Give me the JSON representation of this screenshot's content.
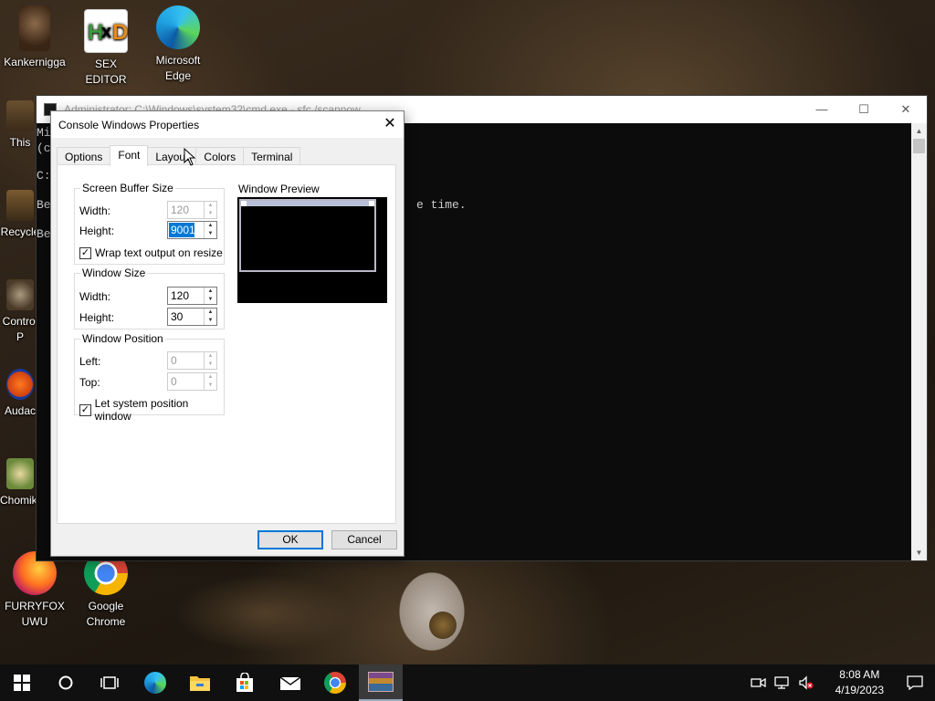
{
  "desktop": {
    "icons": [
      {
        "label": "Kankernigga"
      },
      {
        "label": "SEX\nEDITOR"
      },
      {
        "label": "Microsoft\nEdge"
      },
      {
        "label": "This"
      },
      {
        "label": "Recycle"
      },
      {
        "label": "Control P"
      },
      {
        "label": "Audac"
      },
      {
        "label": "ChomikS"
      },
      {
        "label": "FURRYFOX\nUWU"
      },
      {
        "label": "Google\nChrome"
      }
    ]
  },
  "console": {
    "title": "Administrator: C:\\Windows\\system32\\cmd.exe - sfc /scannow",
    "lines": [
      "Mi",
      "(c",
      "C:",
      "Be",
      "Be"
    ],
    "text_fragment": "e time."
  },
  "dialog": {
    "title": "Console Windows Properties",
    "tabs": [
      "Options",
      "Font",
      "Layout",
      "Colors",
      "Terminal"
    ],
    "active_tab": "Font",
    "screen_buffer": {
      "title": "Screen Buffer Size",
      "width_label": "Width:",
      "width_value": "120",
      "height_label": "Height:",
      "height_value": "9001",
      "wrap_label": "Wrap text output on resize",
      "wrap_checked": true
    },
    "window_size": {
      "title": "Window Size",
      "width_label": "Width:",
      "width_value": "120",
      "height_label": "Height:",
      "height_value": "30"
    },
    "window_position": {
      "title": "Window Position",
      "left_label": "Left:",
      "left_value": "0",
      "top_label": "Top:",
      "top_value": "0",
      "system_label": "Let system position window",
      "system_checked": true
    },
    "preview_label": "Window Preview",
    "ok_label": "OK",
    "cancel_label": "Cancel",
    "close_glyph": "✕"
  },
  "taskbar": {
    "time": "8:08 AM",
    "date": "4/19/2023",
    "apps": [
      "windows-start",
      "search",
      "task-view",
      "edge",
      "file-explorer",
      "store",
      "mail",
      "chrome",
      "winrar"
    ]
  },
  "colors": {
    "accent": "#0078d7",
    "taskbar": "#101010"
  }
}
